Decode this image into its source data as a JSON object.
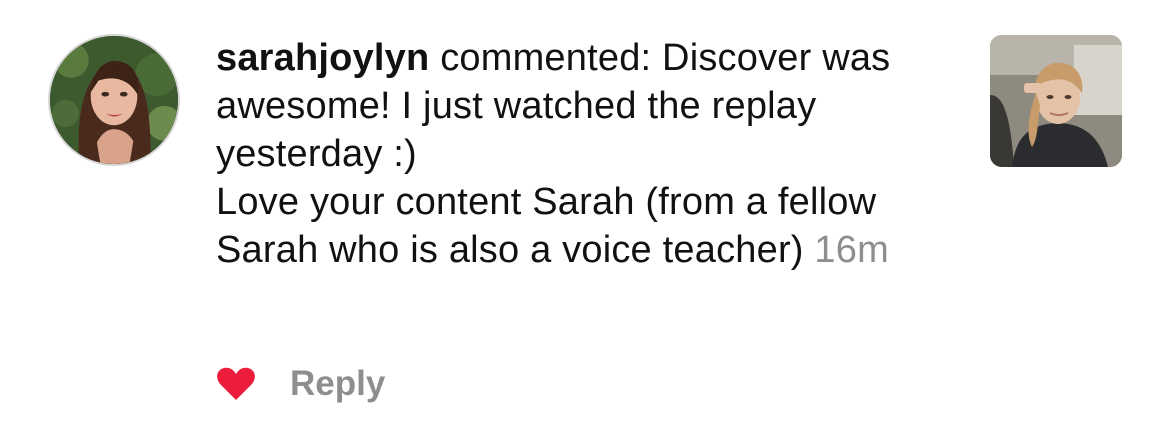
{
  "comment": {
    "username": "sarahjoylyn",
    "action_text": "commented:",
    "text_line1": "Discover was awesome! I just watched the replay yesterday :)",
    "text_line2": "Love your content Sarah (from a fellow Sarah who is also a voice teacher)",
    "timestamp": "16m"
  },
  "actions": {
    "like_icon": "heart-filled-icon",
    "like_color": "#ed1c3c",
    "reply_label": "Reply"
  },
  "media": {
    "avatar": "user-avatar-photo",
    "thumbnail": "post-thumbnail-photo"
  }
}
